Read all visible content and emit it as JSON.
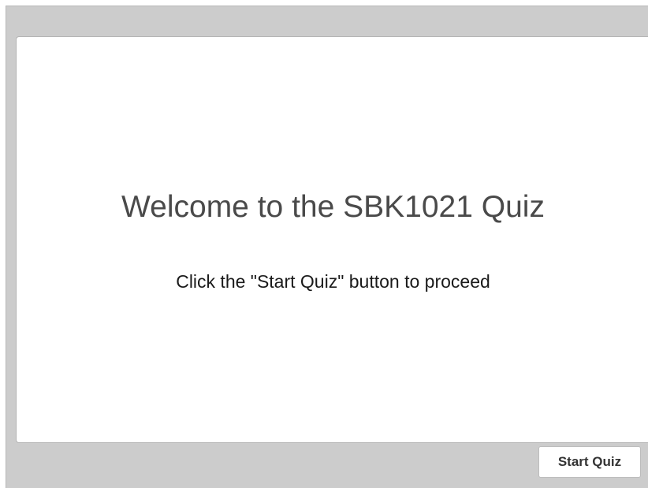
{
  "slide": {
    "title": "Welcome to the SBK1021 Quiz",
    "instruction": "Click the \"Start Quiz\" button to proceed"
  },
  "controls": {
    "start_label": "Start Quiz"
  },
  "colors": {
    "frame_background": "#cccccc",
    "card_background": "#ffffff",
    "title_text": "#4a4a4a"
  }
}
